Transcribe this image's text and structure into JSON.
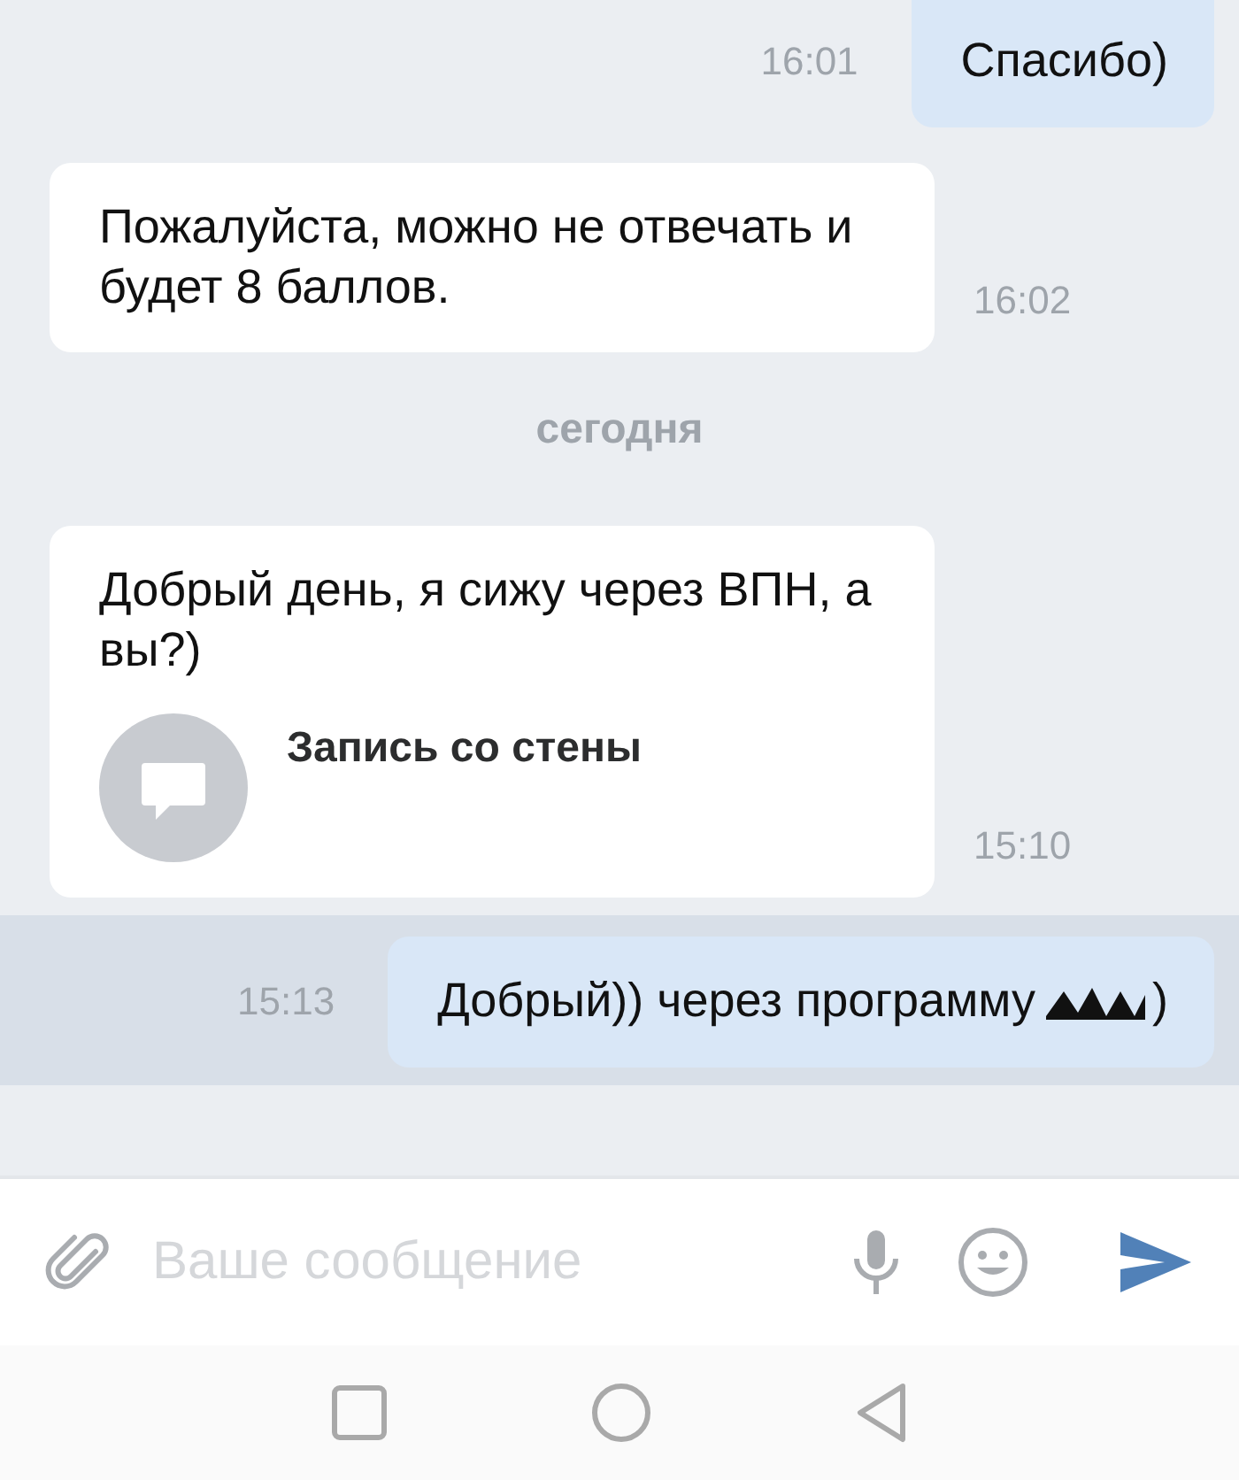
{
  "messages": [
    {
      "kind": "outgoing",
      "text": "Спасибо)",
      "time": "16:01",
      "selected": false
    },
    {
      "kind": "incoming",
      "text": "Пожалуйста, можно не отвечать и будет 8 баллов.",
      "time": "16:02",
      "selected": false
    },
    {
      "kind": "date",
      "text": "сегодня"
    },
    {
      "kind": "incoming",
      "text": "Добрый день, я сижу через ВПН, а вы?)",
      "attachment": "Запись со стены",
      "time": "15:10",
      "selected": false
    },
    {
      "kind": "outgoing",
      "text": "Добрый)) через программу",
      "redacted": true,
      "tail": ")",
      "time": "15:13",
      "selected": true
    }
  ],
  "composer": {
    "placeholder": "Ваше сообщение"
  }
}
